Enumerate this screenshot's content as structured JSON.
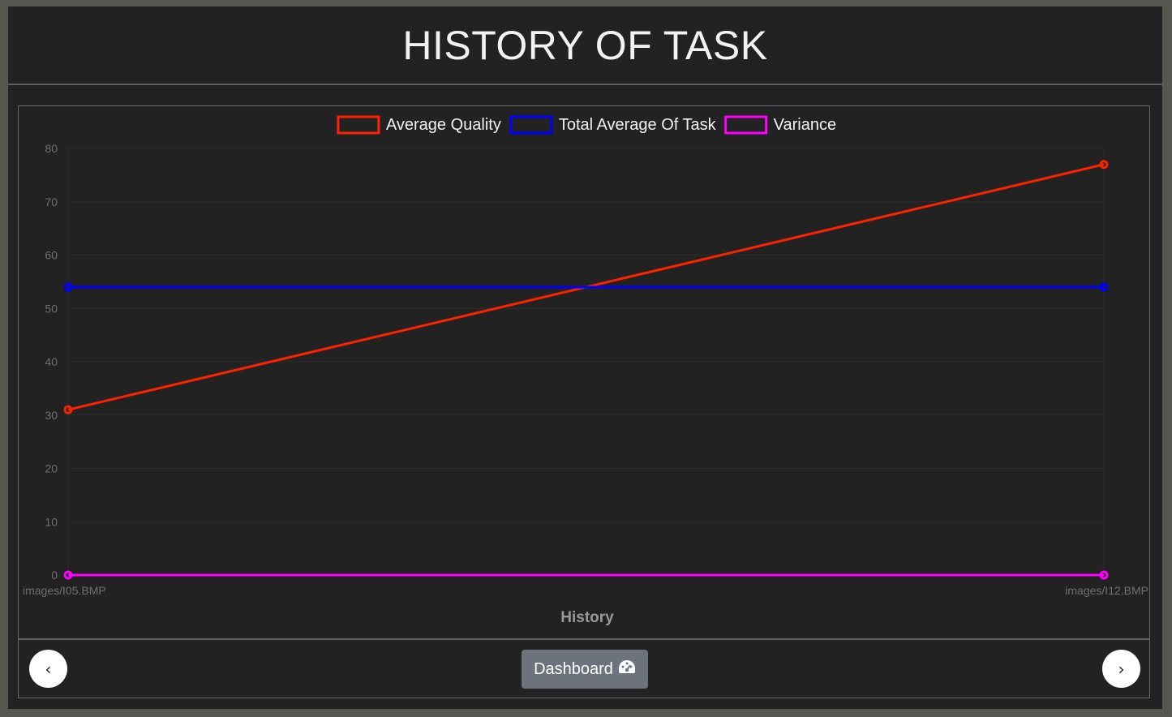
{
  "page": {
    "title": "HISTORY OF TASK"
  },
  "chart_data": {
    "type": "line",
    "categories": [
      "images/I05.BMP",
      "images/I12.BMP"
    ],
    "series": [
      {
        "name": "Average Quality",
        "values": [
          31,
          77
        ],
        "color": "#ff2200"
      },
      {
        "name": "Total Average Of Task",
        "values": [
          54,
          54
        ],
        "color": "#0000ff"
      },
      {
        "name": "Variance",
        "values": [
          0,
          0
        ],
        "color": "#ff00ff"
      }
    ],
    "xlabel": "History",
    "ylabel": "",
    "ylim": [
      0,
      80
    ],
    "yticks": [
      0,
      10,
      20,
      30,
      40,
      50,
      60,
      70,
      80
    ],
    "legend": "top-center",
    "grid": true
  },
  "footer": {
    "prev_icon": "‹",
    "next_icon": "›",
    "dashboard_label": "Dashboard",
    "dashboard_icon": "tachometer-icon"
  }
}
